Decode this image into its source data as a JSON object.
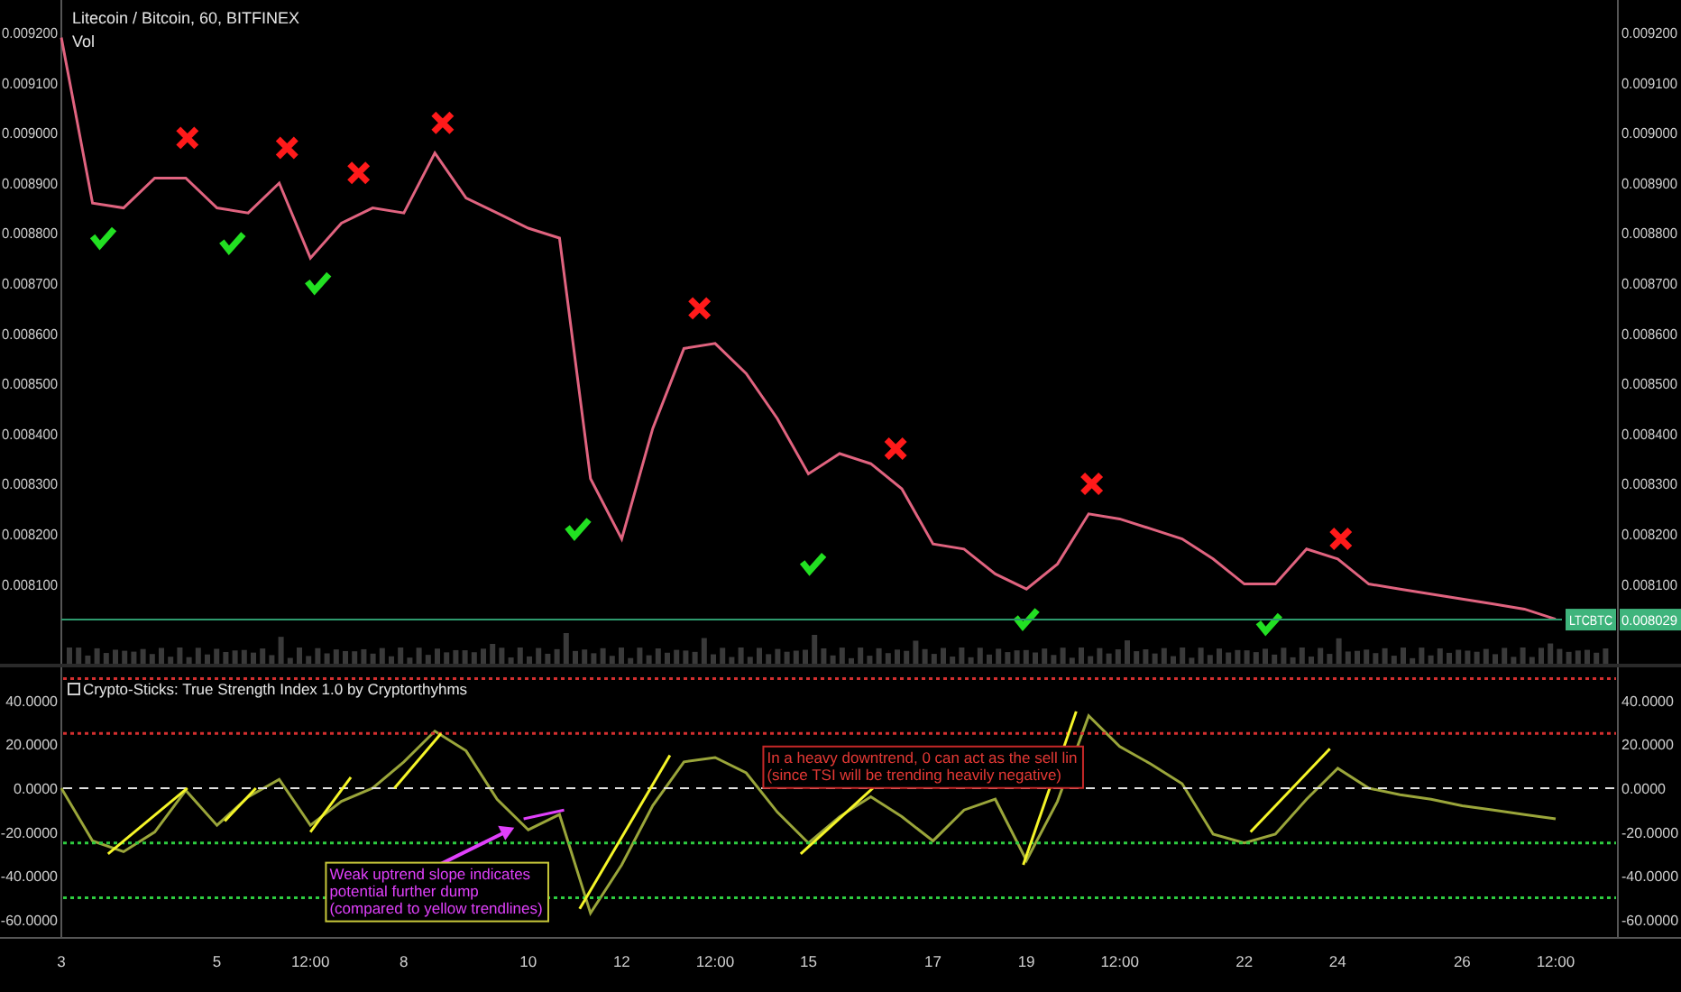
{
  "main_pane": {
    "title": "Litecoin / Bitcoin, 60, BITFINEX",
    "subtitle": "Vol",
    "symbol_badge": "LTCBTC",
    "price_badge": "0.008029",
    "chart_data": {
      "type": "line",
      "ylim": [
        0.007941,
        0.009265
      ],
      "yticks": [
        {
          "value": 0.0092,
          "label": "0.009200"
        },
        {
          "value": 0.0091,
          "label": "0.009100"
        },
        {
          "value": 0.009,
          "label": "0.009000"
        },
        {
          "value": 0.0089,
          "label": "0.008900"
        },
        {
          "value": 0.0088,
          "label": "0.008800"
        },
        {
          "value": 0.0087,
          "label": "0.008700"
        },
        {
          "value": 0.0086,
          "label": "0.008600"
        },
        {
          "value": 0.0085,
          "label": "0.008500"
        },
        {
          "value": 0.0084,
          "label": "0.008400"
        },
        {
          "value": 0.0083,
          "label": "0.008300"
        },
        {
          "value": 0.0082,
          "label": "0.008200"
        },
        {
          "value": 0.0081,
          "label": "0.008100"
        }
      ],
      "categories": [
        null,
        null,
        null,
        null,
        null,
        null,
        null,
        null,
        null,
        null,
        null,
        null,
        null,
        null,
        null,
        null,
        null,
        null,
        null,
        null,
        null,
        null,
        null,
        null,
        null,
        null,
        null,
        null,
        null,
        null,
        null,
        null,
        null,
        null,
        null,
        null,
        null,
        null,
        null,
        null,
        null,
        null,
        null,
        null,
        null,
        null,
        null,
        null,
        null
      ],
      "series": [
        {
          "color": "#e0637f",
          "values": [
            0.00919,
            0.00886,
            0.00885,
            0.00891,
            0.00891,
            0.00885,
            0.00884,
            0.0089,
            0.00875,
            0.00882,
            0.00885,
            0.00884,
            0.00896,
            0.00887,
            0.00884,
            0.00881,
            0.00879,
            0.00831,
            0.00819,
            0.00841,
            0.00857,
            0.00858,
            0.00852,
            0.00843,
            0.00832,
            0.00836,
            0.00834,
            0.00829,
            0.00818,
            0.00817,
            0.00812,
            0.00809,
            0.00814,
            0.00824,
            0.00823,
            0.00821,
            0.00819,
            0.00815,
            0.0081,
            0.0081,
            0.00817,
            0.00815,
            0.0081,
            0.00809,
            0.00808,
            0.00807,
            0.00806,
            0.00805,
            0.00803
          ]
        }
      ]
    }
  },
  "indicator_pane": {
    "title": "Crypto-Sticks: True Strength Index 1.0 by Cryptorthyhms",
    "notes": [
      {
        "color": "#e53935",
        "lines": [
          "In a heavy downtrend, 0 can act as the sell lin",
          "(since TSI will be trending heavily negative)"
        ]
      },
      {
        "color": "#e040fb",
        "lines": [
          "Weak uptrend slope indicates",
          "potential further dump",
          "(compared to yellow trendlines)"
        ]
      }
    ],
    "chart_data": {
      "type": "line",
      "ylim": [
        -68.3,
        55.1
      ],
      "yticks": [
        {
          "value": 40,
          "label": "40.0000"
        },
        {
          "value": 20,
          "label": "20.0000"
        },
        {
          "value": 0,
          "label": "0.0000"
        },
        {
          "value": -20,
          "label": "-20.0000"
        },
        {
          "value": -40,
          "label": "-40.0000"
        },
        {
          "value": -60,
          "label": "-60.0000"
        }
      ],
      "categories": [
        "3",
        null,
        null,
        null,
        null,
        "5",
        null,
        null,
        "12:00",
        null,
        null,
        "8",
        null,
        null,
        null,
        "10",
        null,
        null,
        "12",
        null,
        null,
        "12:00",
        null,
        null,
        "15",
        null,
        null,
        null,
        "17",
        null,
        null,
        "19",
        null,
        null,
        "12:00",
        null,
        null,
        null,
        "22",
        null,
        null,
        "24",
        null,
        null,
        null,
        "26",
        null,
        null,
        "12:00"
      ],
      "series": [
        {
          "color": "#9aa53a",
          "values": [
            0,
            -24,
            -29,
            -20,
            -1,
            -17,
            -4,
            4,
            -17,
            -6,
            0,
            12,
            26,
            17,
            -5,
            -19,
            -12,
            -57,
            -35,
            -8,
            12,
            14,
            7,
            -11,
            -25,
            -13,
            -4,
            -13,
            -24,
            -10,
            -5,
            -33,
            -6,
            33,
            19,
            11,
            2,
            -21,
            -25,
            -21,
            -5,
            9,
            0,
            -3,
            -5,
            -8,
            -10,
            -12,
            -14
          ]
        }
      ]
    }
  }
}
